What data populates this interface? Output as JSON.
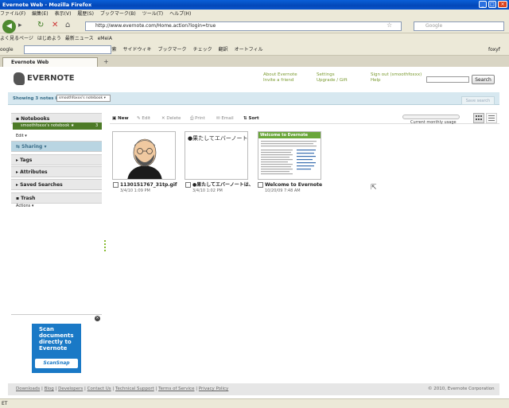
{
  "window": {
    "title": "Evernote Web - Mozilla Firefox"
  },
  "menu": [
    "ファイル(F)",
    "編集(E)",
    "表示(V)",
    "履歴(S)",
    "ブックマーク(B)",
    "ツール(T)",
    "ヘルプ(H)"
  ],
  "nav": {
    "url": "http://www.evernote.com/Home.action?login=true",
    "search_placeholder": "Google"
  },
  "bookmarks": [
    "よく見るページ",
    "はじめよう",
    "最新ニュース",
    "eMeiA"
  ],
  "toolbar2": {
    "google": "oogle",
    "items": [
      "検索",
      "サイドウィキ",
      "ブックマーク",
      "チェック",
      "翻訳",
      "オートフィル"
    ],
    "user": "foxyf"
  },
  "tab": {
    "title": "Evernote Web"
  },
  "app": {
    "logo": "EVERNOTE",
    "links": {
      "about": "About Evernote",
      "invite": "Invite a friend",
      "settings": "Settings",
      "upgrade": "Upgrade / Gift",
      "signout": "Sign out (smoothfoxxx)",
      "help": "Help"
    },
    "search_button": "Search",
    "showing": "Showing 3 notes in",
    "notebook_select": "smoothfoxxx's notebook",
    "save_search": "Save search",
    "sidebar": {
      "notebooks": "Notebooks",
      "notebook_item": "smoothfoxxx's notebook ★",
      "notebook_count": "3",
      "edit": "Edit",
      "sharing": "Sharing",
      "tags": "Tags",
      "attributes": "Attributes",
      "saved_searches": "Saved Searches",
      "trash": "Trash",
      "actions": "Actions"
    },
    "ad": {
      "line1": "Scan",
      "line2": "documents",
      "line3": "directly to",
      "line4": "Evernote",
      "brand": "ScanSnap"
    },
    "actions": {
      "new": "New",
      "edit": "Edit",
      "delete": "Delete",
      "print": "Print",
      "email": "Email",
      "sort": "Sort"
    },
    "usage_label": "Current monthly usage",
    "notes": [
      {
        "title": "1130151767_31tp.gif",
        "date": "3/4/10 1:09 PM"
      },
      {
        "title": "●果たしてエバーノートは、",
        "date": "3/4/10 1:02 PM",
        "snippet": "●果たしてエバーノート"
      },
      {
        "title": "Welcome to Evernote",
        "date": "10/20/09 7:48 AM",
        "thumb_heading": "Welcome to Evernote"
      }
    ],
    "footer": {
      "links": [
        "Downloads",
        "Blog",
        "Developers",
        "Contact Us",
        "Technical Support",
        "Terms of Service",
        "Privacy Policy"
      ],
      "copyright": "© 2010, Evernote Corporation"
    }
  },
  "status": "ET"
}
